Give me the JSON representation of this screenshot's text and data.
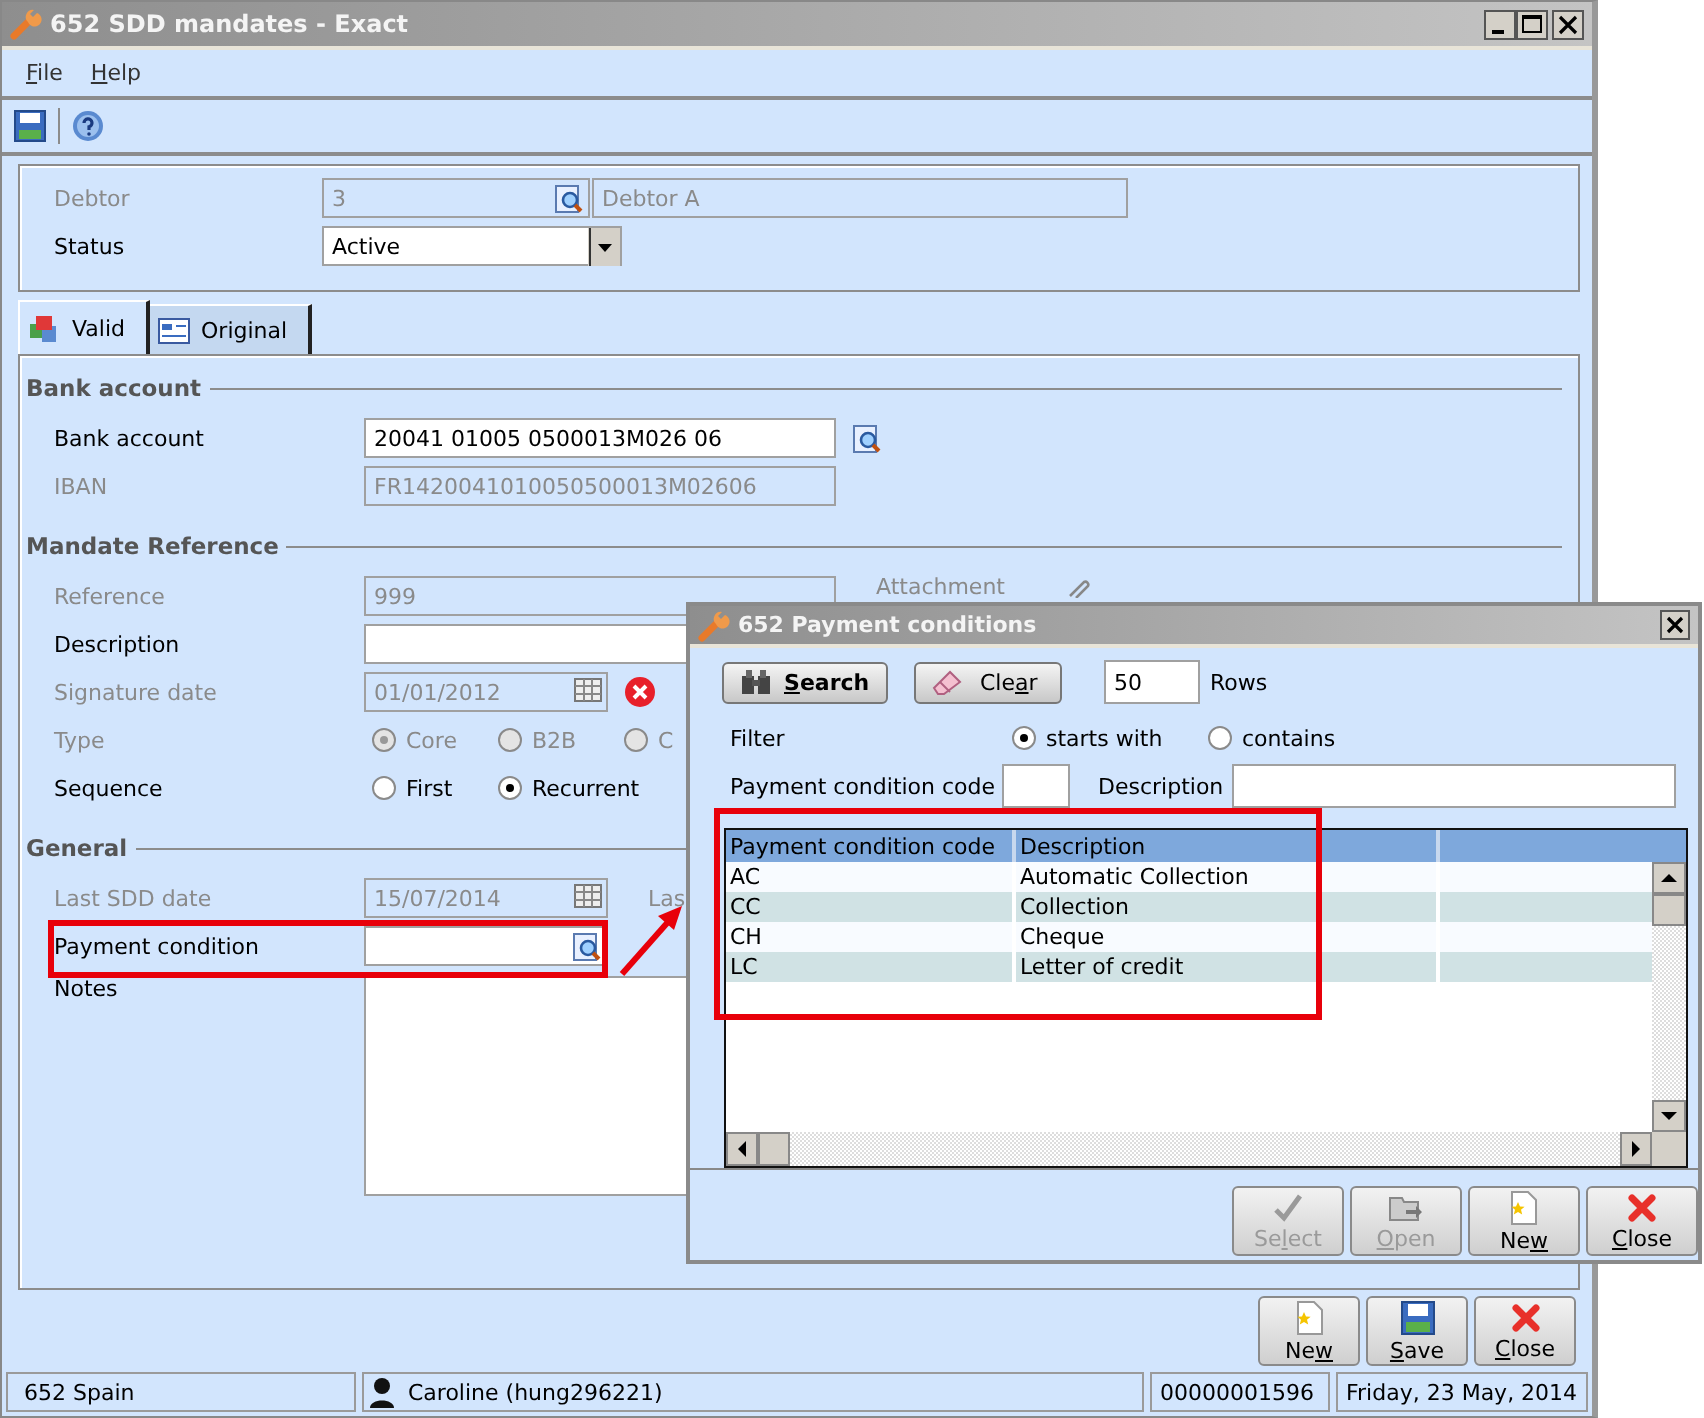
{
  "window": {
    "title": "652 SDD mandates - Exact"
  },
  "menu": [
    {
      "label": "File"
    },
    {
      "label": "Help"
    }
  ],
  "header": [
    {
      "label": "Debtor",
      "kind": "lookup",
      "disabled": true,
      "value": "3",
      "name": "Debtor A"
    },
    {
      "label": "Status",
      "kind": "dropdown",
      "disabled": false,
      "value": "Active"
    }
  ],
  "tabs": [
    {
      "label": "Valid",
      "selected": true
    },
    {
      "label": "Original",
      "selected": false
    }
  ],
  "sections": [
    {
      "title": "Bank account",
      "rows": [
        {
          "label": "Bank account",
          "kind": "text",
          "disabled": false,
          "value": "20041 01005 0500013M026 06",
          "lookup_button": true
        },
        {
          "label": "IBAN",
          "kind": "text",
          "disabled": true,
          "value": "FR1420041010050500013M02606"
        }
      ]
    },
    {
      "title": "Mandate Reference",
      "rows": [
        {
          "label": "Reference",
          "kind": "text",
          "disabled": true,
          "value": "999",
          "side": {
            "label": "Attachment",
            "kind": "attachment"
          }
        },
        {
          "label": "Description",
          "kind": "text",
          "disabled": false
        },
        {
          "label": "Signature date",
          "kind": "date",
          "disabled": true,
          "value": "01/01/2012",
          "clearable": true
        },
        {
          "label": "Type",
          "kind": "radio",
          "disabled": true,
          "options": [
            {
              "label": "Core",
              "selected": true
            },
            {
              "label": "B2B",
              "selected": false
            },
            {
              "label": "C",
              "selected": false
            }
          ]
        },
        {
          "label": "Sequence",
          "kind": "radio",
          "disabled": false,
          "options": [
            {
              "label": "First",
              "selected": false
            },
            {
              "label": "Recurrent",
              "selected": true
            }
          ]
        }
      ]
    },
    {
      "title": "General",
      "rows": [
        {
          "label": "Last SDD date",
          "kind": "date",
          "disabled": true,
          "value": "15/07/2014",
          "side": {
            "label": "Las",
            "kind": "label"
          }
        },
        {
          "label": "Payment condition",
          "kind": "lookup",
          "disabled": false
        },
        {
          "label": "Notes",
          "kind": "textarea",
          "disabled": false
        }
      ]
    }
  ],
  "buttons": [
    {
      "label": "New",
      "kind": "new",
      "disabled": false
    },
    {
      "label": "Save",
      "kind": "save",
      "disabled": false
    },
    {
      "label": "Close",
      "kind": "close",
      "disabled": false
    }
  ],
  "status_bar": [
    {
      "text": "652 Spain"
    },
    {
      "text": "Caroline (hung296221)"
    },
    {
      "text": "00000001596"
    },
    {
      "text": "Friday, 23 May, 2014"
    }
  ],
  "dialog": {
    "title": "652 Payment conditions",
    "search_button": {
      "label": "Search"
    },
    "clear_button": {
      "label": "Clear"
    },
    "rows_value": "50",
    "rows_label": "Rows",
    "filter": {
      "label": "Filter",
      "options": [
        {
          "label": "starts with",
          "selected": true
        },
        {
          "label": "contains",
          "selected": false
        }
      ]
    },
    "criteria": [
      {
        "label": "Payment condition code"
      },
      {
        "label": "Description"
      }
    ],
    "table": {
      "columns": [
        "Payment condition code",
        "Description"
      ],
      "rows": [
        {
          "code": "AC",
          "description": "Automatic Collection"
        },
        {
          "code": "CC",
          "description": "Collection"
        },
        {
          "code": "CH",
          "description": "Cheque"
        },
        {
          "code": "LC",
          "description": "Letter of credit"
        }
      ]
    },
    "buttons": [
      {
        "label": "Select",
        "kind": "select",
        "disabled": true
      },
      {
        "label": "Open",
        "kind": "open",
        "disabled": true
      },
      {
        "label": "New",
        "kind": "new",
        "disabled": false
      },
      {
        "label": "Close",
        "kind": "close",
        "disabled": false
      }
    ]
  },
  "annotations": [
    {
      "kind": "frame"
    },
    {
      "kind": "frame"
    },
    {
      "kind": "arrow"
    }
  ]
}
